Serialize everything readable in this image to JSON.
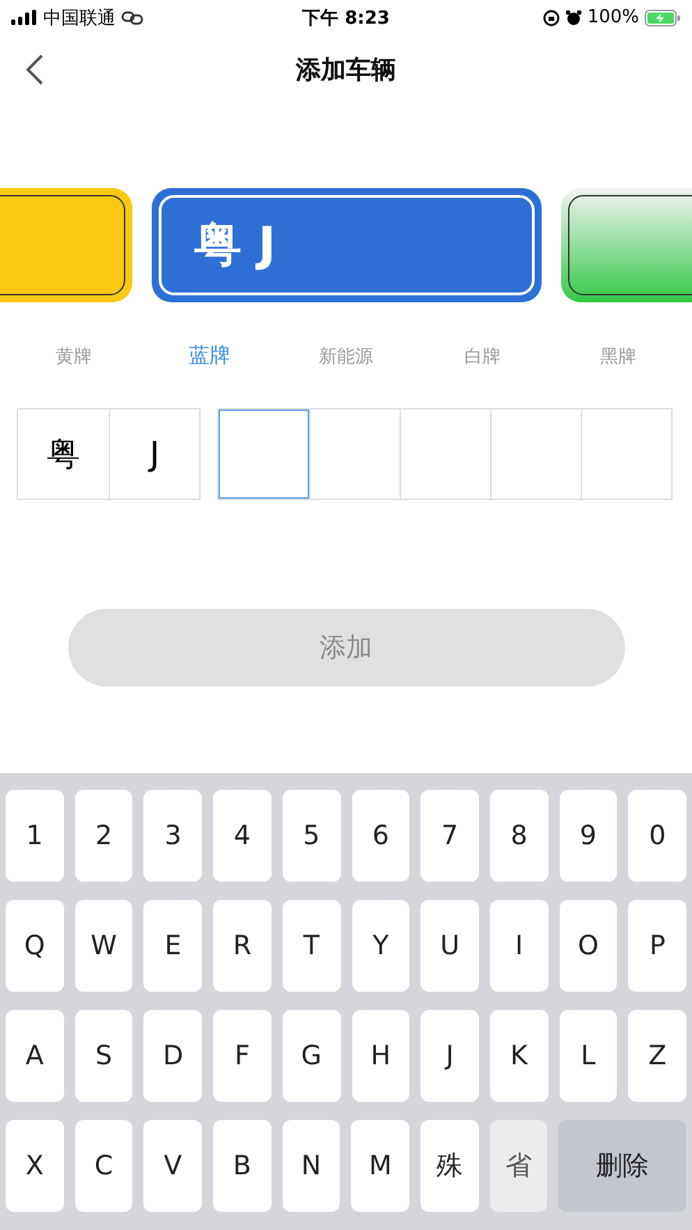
{
  "status_bar": {
    "carrier": "中国联通",
    "time": "下午 8:23",
    "battery": "100%"
  },
  "nav": {
    "title": "添加车辆"
  },
  "plates": [
    {
      "kind": "yellow"
    },
    {
      "kind": "blue",
      "text": "粤 J"
    },
    {
      "kind": "green"
    }
  ],
  "tabs": [
    {
      "label": "黄牌",
      "selected": false
    },
    {
      "label": "蓝牌",
      "selected": true
    },
    {
      "label": "新能源",
      "selected": false
    },
    {
      "label": "白牌",
      "selected": false
    },
    {
      "label": "黑牌",
      "selected": false
    }
  ],
  "prefix_cells": [
    "粤",
    "J"
  ],
  "number_cells": [
    {
      "selected": true
    },
    {
      "selected": false
    },
    {
      "selected": false
    },
    {
      "selected": false
    },
    {
      "selected": false
    }
  ],
  "add_button": {
    "label": "添加",
    "disabled": true
  },
  "keyboard": [
    [
      {
        "label": "1",
        "kind": "char"
      },
      {
        "label": "2",
        "kind": "char"
      },
      {
        "label": "3",
        "kind": "char"
      },
      {
        "label": "4",
        "kind": "char"
      },
      {
        "label": "5",
        "kind": "char"
      },
      {
        "label": "6",
        "kind": "char"
      },
      {
        "label": "7",
        "kind": "char"
      },
      {
        "label": "8",
        "kind": "char"
      },
      {
        "label": "9",
        "kind": "char"
      },
      {
        "label": "0",
        "kind": "char"
      }
    ],
    [
      {
        "label": "Q",
        "kind": "char"
      },
      {
        "label": "W",
        "kind": "char"
      },
      {
        "label": "E",
        "kind": "char"
      },
      {
        "label": "R",
        "kind": "char"
      },
      {
        "label": "T",
        "kind": "char"
      },
      {
        "label": "Y",
        "kind": "char"
      },
      {
        "label": "U",
        "kind": "char"
      },
      {
        "label": "I",
        "kind": "char"
      },
      {
        "label": "O",
        "kind": "char"
      },
      {
        "label": "P",
        "kind": "char"
      }
    ],
    [
      {
        "label": "A",
        "kind": "char"
      },
      {
        "label": "S",
        "kind": "char"
      },
      {
        "label": "D",
        "kind": "char"
      },
      {
        "label": "F",
        "kind": "char"
      },
      {
        "label": "G",
        "kind": "char"
      },
      {
        "label": "H",
        "kind": "char"
      },
      {
        "label": "J",
        "kind": "char"
      },
      {
        "label": "K",
        "kind": "char"
      },
      {
        "label": "L",
        "kind": "char"
      },
      {
        "label": "Z",
        "kind": "char"
      }
    ],
    [
      {
        "label": "X",
        "kind": "char"
      },
      {
        "label": "C",
        "kind": "char"
      },
      {
        "label": "V",
        "kind": "char"
      },
      {
        "label": "B",
        "kind": "char"
      },
      {
        "label": "N",
        "kind": "char"
      },
      {
        "label": "M",
        "kind": "char"
      },
      {
        "label": "殊",
        "kind": "char"
      },
      {
        "label": "省",
        "kind": "disabled"
      },
      {
        "label": "删除",
        "kind": "delete"
      }
    ]
  ]
}
